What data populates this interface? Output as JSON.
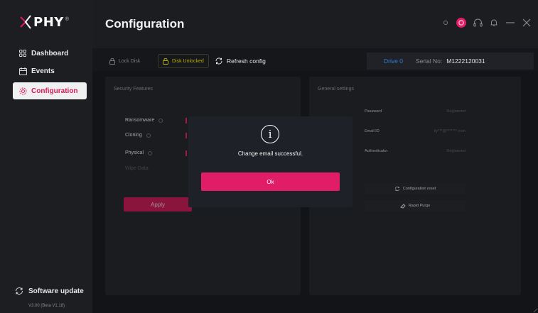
{
  "app": {
    "logo_text": "PHY",
    "logo_reg": "®"
  },
  "sidebar": {
    "items": [
      {
        "label": "Dashboard",
        "icon": "grid-icon"
      },
      {
        "label": "Events",
        "icon": "calendar-icon"
      },
      {
        "label": "Configuration",
        "icon": "gear-icon",
        "active": true
      }
    ],
    "software_update": "Software update",
    "version": "V3.00 (Beta V1.18)"
  },
  "header": {
    "title": "Configuration",
    "icons": [
      "sun-icon",
      "avatar-badge",
      "headset-icon",
      "bell-icon",
      "minimize-icon",
      "close-icon"
    ]
  },
  "toolbar": {
    "lock_disk": "Lock Disk",
    "disk_unlocked": "Disk Unlocked",
    "refresh_config": "Refresh config",
    "drive": "Drive 0",
    "serial_label": "Serial No:",
    "serial_value": "M1222120031"
  },
  "security": {
    "title": "Security Features",
    "features": [
      "Ransomware",
      "Cloning",
      "Physical",
      "Wipe Data"
    ],
    "apply": "Apply"
  },
  "general": {
    "title": "General settings",
    "rows": [
      {
        "key": "Password",
        "value": "Registered"
      },
      {
        "key": "Email ID",
        "value": "ky***@*******.com"
      },
      {
        "key": "Authenticator",
        "value": "Registered"
      }
    ],
    "config_reset": "Configuration reset",
    "rapid_purge": "Rapid Purge"
  },
  "modal": {
    "icon": "info-icon",
    "message": "Change email successful.",
    "ok": "Ok"
  },
  "colors": {
    "accent": "#e21d68",
    "drive_blue": "#2f7fd8",
    "unlocked_yellow": "#b8b000"
  }
}
